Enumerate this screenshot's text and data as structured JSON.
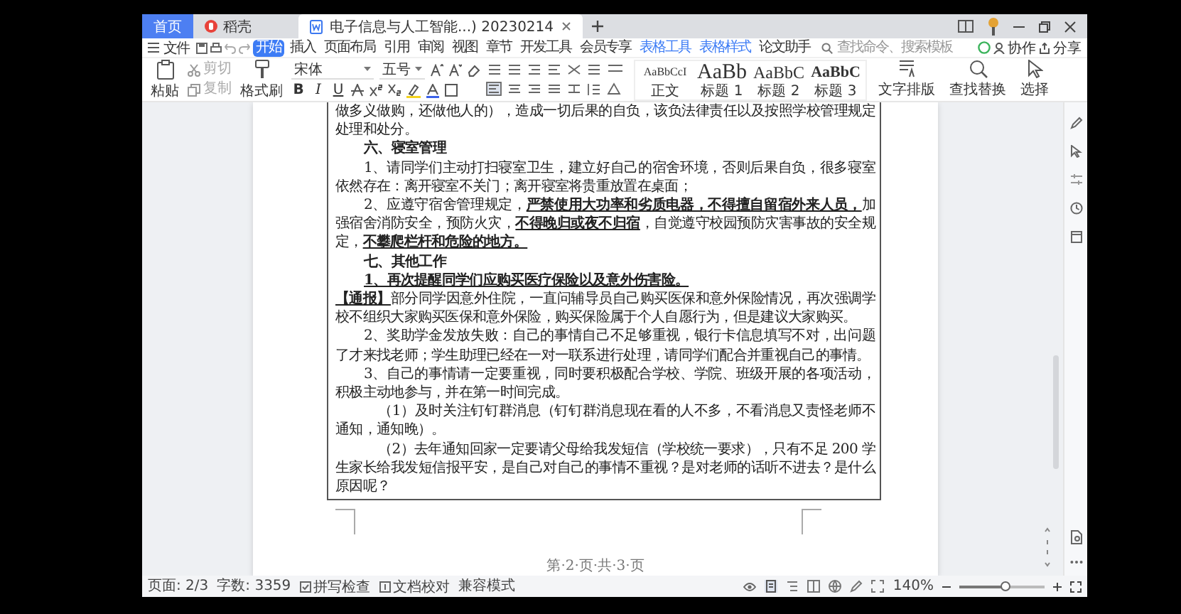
{
  "tab_bar": {
    "tabs": [
      {
        "label": "首页",
        "kind": "home",
        "selected": false
      },
      {
        "label": "稻壳",
        "kind": "app",
        "selected": false
      },
      {
        "label": "电子信息与人工智能...) 20230214",
        "kind": "document",
        "selected": true
      }
    ]
  },
  "menu": {
    "file": "文件",
    "tabs": [
      {
        "label": "开始",
        "selected": true,
        "contextual": false
      },
      {
        "label": "插入",
        "selected": false,
        "contextual": false
      },
      {
        "label": "页面布局",
        "selected": false,
        "contextual": false
      },
      {
        "label": "引用",
        "selected": false,
        "contextual": false
      },
      {
        "label": "审阅",
        "selected": false,
        "contextual": false
      },
      {
        "label": "视图",
        "selected": false,
        "contextual": false
      },
      {
        "label": "章节",
        "selected": false,
        "contextual": false
      },
      {
        "label": "开发工具",
        "selected": false,
        "contextual": false
      },
      {
        "label": "会员专享",
        "selected": false,
        "contextual": false
      },
      {
        "label": "表格工具",
        "selected": false,
        "contextual": true
      },
      {
        "label": "表格样式",
        "selected": false,
        "contextual": true
      },
      {
        "label": "论文助手",
        "selected": false,
        "contextual": false
      }
    ],
    "search": {
      "placeholder": "查找命令、搜索模板"
    },
    "collab": "协作",
    "share": "分享"
  },
  "toolbar": {
    "paste": "粘贴",
    "cut": {
      "label": "剪切",
      "disabled": true
    },
    "copy": {
      "label": "复制",
      "disabled": true
    },
    "format_painter": "格式刷",
    "font": "宋体",
    "size": "五号",
    "format_buttons": [
      "B",
      "I",
      "U"
    ],
    "styles": [
      {
        "sample": "AaBbCcI",
        "label": "正文",
        "kind": "body"
      },
      {
        "sample": "AaBb",
        "label": "标题 1",
        "kind": "h1"
      },
      {
        "sample": "AaBbC",
        "label": "标题 2",
        "kind": "h2"
      },
      {
        "sample": "AaBbC",
        "label": "标题 3",
        "kind": "h3"
      }
    ],
    "tools": [
      {
        "label": "文字排版",
        "kind": "layout"
      },
      {
        "label": "查找替换",
        "kind": "find"
      },
      {
        "label": "选择",
        "kind": "select"
      }
    ]
  },
  "document": {
    "paragraphs": [
      {
        "kind": "flush",
        "text": "做多义做购，还做他人的），造成一切后果的自负，该负法律责任以及按照学校管理规定处理和处分。"
      },
      {
        "kind": "heading",
        "text": "六、寝室管理"
      },
      {
        "kind": "text",
        "text": "1、请同学们主动打扫寝室卫生，建立好自己的宿舍环境，否则后果自负，很多寝室依然存在：离开寝室不关门；离开寝室将贵重放置在桌面；"
      },
      {
        "kind": "text",
        "text": "2、应遵守宿舍管理规定，**严禁使用大功率和劣质电器，不得擅自留宿外来人员，**加强宿舍消防安全，预防火灾，**不得晚归或夜不归宿**，自觉遵守校园预防灾害事故的安全规定，**不攀爬栏杆和危险的地方。**"
      },
      {
        "kind": "heading",
        "text": "七、其他工作"
      },
      {
        "kind": "strong",
        "text": "1、再次提醒同学们应购买医疗保险以及意外伤害险。"
      },
      {
        "kind": "flush",
        "text": "**【通报】**部分同学因意外住院，一直问辅导员自己购买医保和意外保险情况，再次强调学校不组织大家购买医保和意外保险，购买保险属于个人自愿行为，但是建议大家购买。"
      },
      {
        "kind": "text",
        "text": "2、奖助学金发放失败：自己的事情自己不足够重视，银行卡信息填写不对，出问题了才来找老师；学生助理已经在一对一联系进行处理，请同学们配合并重视自己的事情。"
      },
      {
        "kind": "text",
        "text": "3、自己的事情请一定要重视，同时要积极配合学校、学院、班级开展的各项活动，积极主动地参与，并在第一时间完成。"
      },
      {
        "kind": "sub",
        "text": "（1）及时关注钉钉群消息（钉钉群消息现在看的人不多，不看消息又责怪老师不通知，通知晚）。"
      },
      {
        "kind": "sub",
        "text": "（2）去年通知回家一定要请父母给我发短信（学校统一要求），只有不足 200 学生家长给我发短信报平安，是自己对自己的事情不重视？是对老师的话听不进去？是什么原因呢？"
      }
    ],
    "footer": "第·2·页·共·3·页"
  },
  "status_bar": {
    "page": "页面: 2/3",
    "words": "字数: 3359",
    "spell_check": "拼写检查",
    "proofread": "文档校对",
    "compat": "兼容模式",
    "zoom": "140%",
    "zoom_slider": {
      "level": 0.55
    }
  }
}
